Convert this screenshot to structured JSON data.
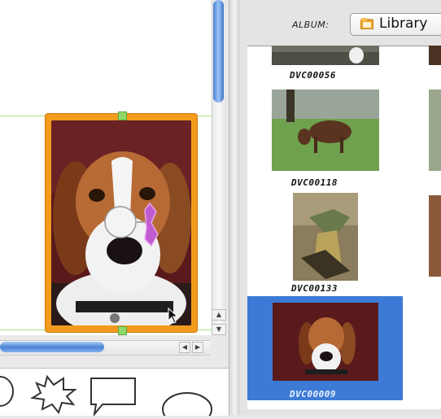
{
  "album": {
    "label": "ALBUM:",
    "selected": "Library"
  },
  "photos": [
    {
      "name": "DVC00056"
    },
    {
      "name": "DVC00118"
    },
    {
      "name": "DVC00133"
    },
    {
      "name": "DVC00009",
      "selected": true
    }
  ],
  "colors": {
    "selection": "#3d7ad6",
    "frame": "#f29b1d",
    "guide": "#a8e58a",
    "handle": "#8fd96a",
    "scroll_thumb": "#4c82d5"
  },
  "icons": {
    "album": "library-folder-icon",
    "scroll_up": "arrow-up-icon",
    "scroll_down": "arrow-down-icon",
    "scroll_left": "arrow-left-icon",
    "scroll_right": "arrow-right-icon",
    "cursor": "mouse-pointer-icon",
    "rotate": "rotate-knob-icon"
  },
  "shapes_tray": [
    "thought-bubble-shape",
    "burst-shape",
    "speech-rectangle-shape",
    "oval-shape"
  ]
}
